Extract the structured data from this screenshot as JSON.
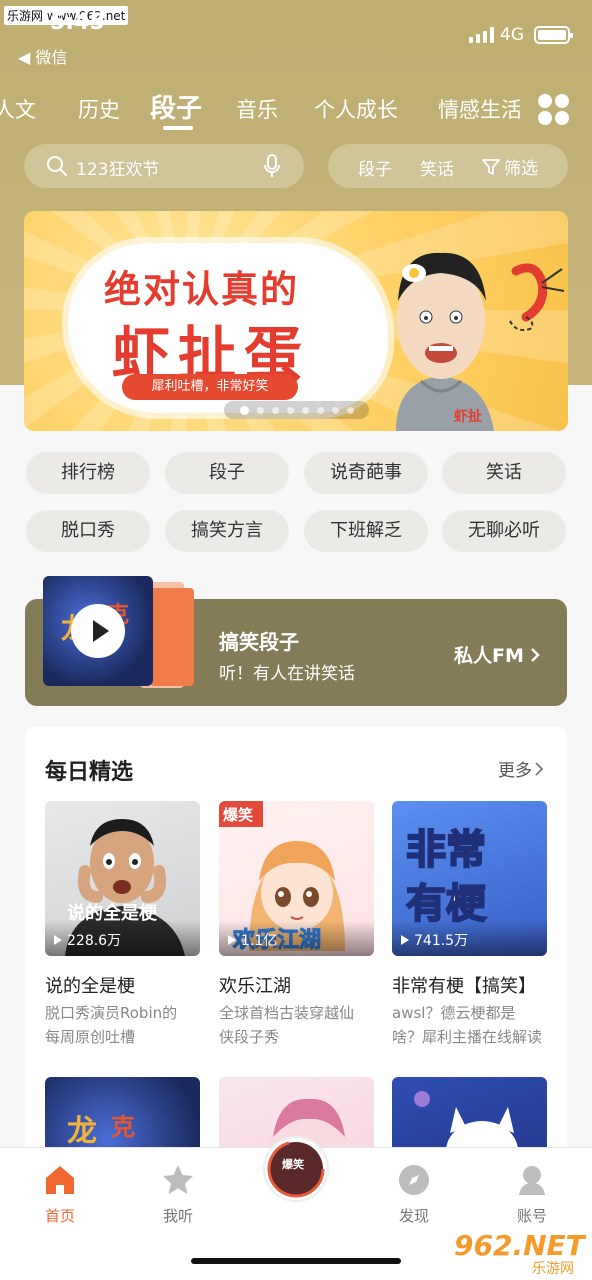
{
  "watermark_top": "乐游网 www.962.net",
  "status": {
    "time": "5:45",
    "back_app": "◀ 微信",
    "network": "4G"
  },
  "tabs": [
    "人文",
    "历史",
    "段子",
    "音乐",
    "个人成长",
    "情感生活"
  ],
  "active_tab": "段子",
  "search": {
    "placeholder": "123狂欢节"
  },
  "filters": [
    "段子",
    "笑话",
    "筛选"
  ],
  "banner": {
    "line1": "绝对认真的",
    "line2": "虾扯蛋",
    "tag": "犀利吐槽，非常好笑",
    "page_count": 8,
    "current_page": 1
  },
  "chips": [
    "排行榜",
    "段子",
    "说奇葩事",
    "笑话",
    "脱口秀",
    "搞笑方言",
    "下班解乏",
    "无聊必听"
  ],
  "fm": {
    "title": "搞笑段子",
    "subtitle": "听！有人在讲笑话",
    "link": "私人FM"
  },
  "daily": {
    "title": "每日精选",
    "more": "更多",
    "items": [
      {
        "title": "说的全是梗",
        "plays": "228.6万",
        "desc1": "脱口秀演员Robin的",
        "desc2": "每周原创吐槽"
      },
      {
        "title": "欢乐江湖",
        "plays": "1.1亿",
        "desc1": "全球首档古装穿越仙",
        "desc2": "侠段子秀"
      },
      {
        "title": "非常有梗【搞笑】",
        "plays": "741.5万",
        "desc1": "awsl？德云梗都是",
        "desc2": "啥？犀利主播在线解读"
      }
    ],
    "cover_texts": [
      "说的全是梗",
      "爆笑 欢乐江湖",
      "非常有梗"
    ]
  },
  "nav": {
    "items": [
      "首页",
      "我听",
      "发现",
      "账号"
    ],
    "active": "首页",
    "center_text": "爆笑"
  },
  "watermark_bottom": {
    "big": "962.NET",
    "small": "乐游网"
  },
  "colors": {
    "accent": "#f06830",
    "header_bg": "#bfae72",
    "fm_bg": "#847c56",
    "banner_red": "#e43d2f"
  }
}
